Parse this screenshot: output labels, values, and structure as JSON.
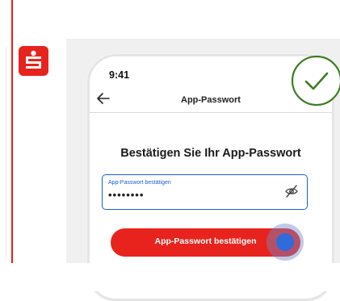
{
  "colors": {
    "brand_red": "#e8231d",
    "accent_blue": "#1c5fd6",
    "success_green": "#3f7d22"
  },
  "brand": {
    "logo_icon": "sparkasse-logo-icon"
  },
  "phone": {
    "status_bar": {
      "time": "9:41"
    },
    "nav": {
      "back_icon": "arrow-left-icon",
      "title": "App-Passwort"
    },
    "page_title": "Bestätigen Sie Ihr App-Passwort",
    "password_field": {
      "label": "App-Passwort bestätigen",
      "value": "••••••••",
      "visibility_icon": "eye-slash-icon"
    },
    "confirm_button": {
      "label": "App-Passwort bestätigen"
    }
  },
  "success_badge": {
    "icon": "checkmark-icon"
  }
}
